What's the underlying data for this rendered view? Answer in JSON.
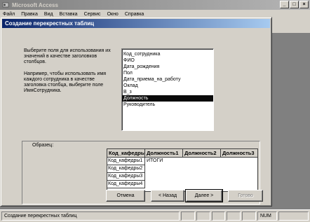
{
  "app": {
    "title": "Microsoft Access",
    "controls": {
      "minimize": "_",
      "maximize": "□",
      "close": "×"
    }
  },
  "menu": [
    "Файл",
    "Правка",
    "Вид",
    "Вставка",
    "Сервис",
    "Окно",
    "Справка"
  ],
  "dialog": {
    "title": "Создание перекрестных таблиц",
    "instruction_1": "Выберите поля для использования их значений в качестве заголовков столбцов.",
    "instruction_2": "Например, чтобы использовать имя каждого сотрудника в качестве заголовка столбца, выберите поле ИмяСотрудника.",
    "fields": [
      "Код_сотрудника",
      "ФИО",
      "Дата_рождения",
      "Пол",
      "Дата_приема_на_работу",
      "Оклад",
      "В_з",
      "Должность",
      "Руководитель"
    ],
    "selected_field": "Должность",
    "sample": {
      "label": "Образец:",
      "columns": [
        "Код_кафедры",
        "Должность1",
        "Должность2",
        "Должность3"
      ],
      "total_label": "ИТОГИ",
      "rows": [
        "Код_кафедры1",
        "Код_кафедры2",
        "Код_кафедры3",
        "Код_кафедры4"
      ]
    },
    "buttons": {
      "cancel": "Отмена",
      "back": "< Назад",
      "next": "Далее >",
      "finish": "Готово"
    }
  },
  "status": {
    "text": "Создание перекрестных таблиц",
    "num": "NUM"
  }
}
